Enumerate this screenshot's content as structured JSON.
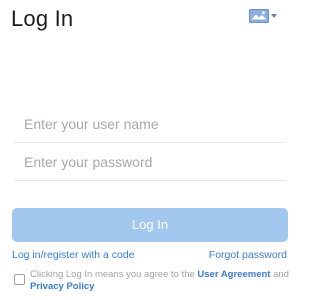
{
  "header": {
    "title": "Log In",
    "language_icon": "flag-icon"
  },
  "form": {
    "username_placeholder": "Enter your user name",
    "username_value": "",
    "password_placeholder": "Enter your password",
    "password_value": "",
    "login_button_label": "Log In"
  },
  "links": {
    "code_login": "Log in/register with a code",
    "forgot_password": "Forgot password"
  },
  "agreement": {
    "checked": false,
    "text_prefix": "Clicking Log In means you agree to the ",
    "user_agreement": "User Agreement",
    "conjunction": " and ",
    "privacy_policy": "Privacy Policy"
  },
  "colors": {
    "accent": "#3a7bd5",
    "button_disabled": "#a3c8f0",
    "placeholder": "#a7a7a7"
  }
}
